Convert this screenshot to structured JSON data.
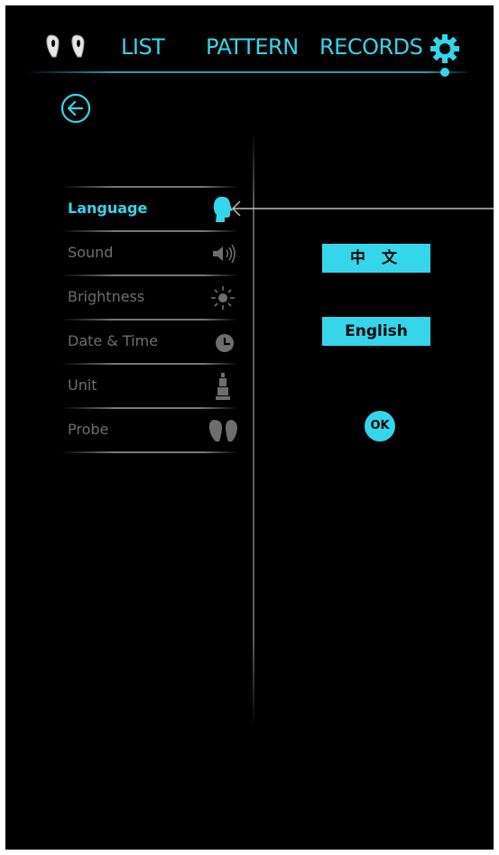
{
  "colors": {
    "accent": "#35d6ea",
    "background": "#000000",
    "inactive": "#6e6e6e"
  },
  "nav": {
    "logo_icon": "probe-pair-icon",
    "tabs": [
      "LIST",
      "PATTERN",
      "RECORDS"
    ],
    "settings_icon": "gear-icon"
  },
  "back_icon": "back-arrow-icon",
  "menu": {
    "items": [
      {
        "label": "Language",
        "icon": "head-icon",
        "active": true
      },
      {
        "label": "Sound",
        "icon": "speaker-icon",
        "active": false
      },
      {
        "label": "Brightness",
        "icon": "sun-icon",
        "active": false
      },
      {
        "label": "Date & Time",
        "icon": "clock-icon",
        "active": false
      },
      {
        "label": "Unit",
        "icon": "figure-icon",
        "active": false
      },
      {
        "label": "Probe",
        "icon": "probe-pair-icon",
        "active": false
      }
    ]
  },
  "options": {
    "chinese": "中 文",
    "english": "English",
    "ok": "OK"
  }
}
